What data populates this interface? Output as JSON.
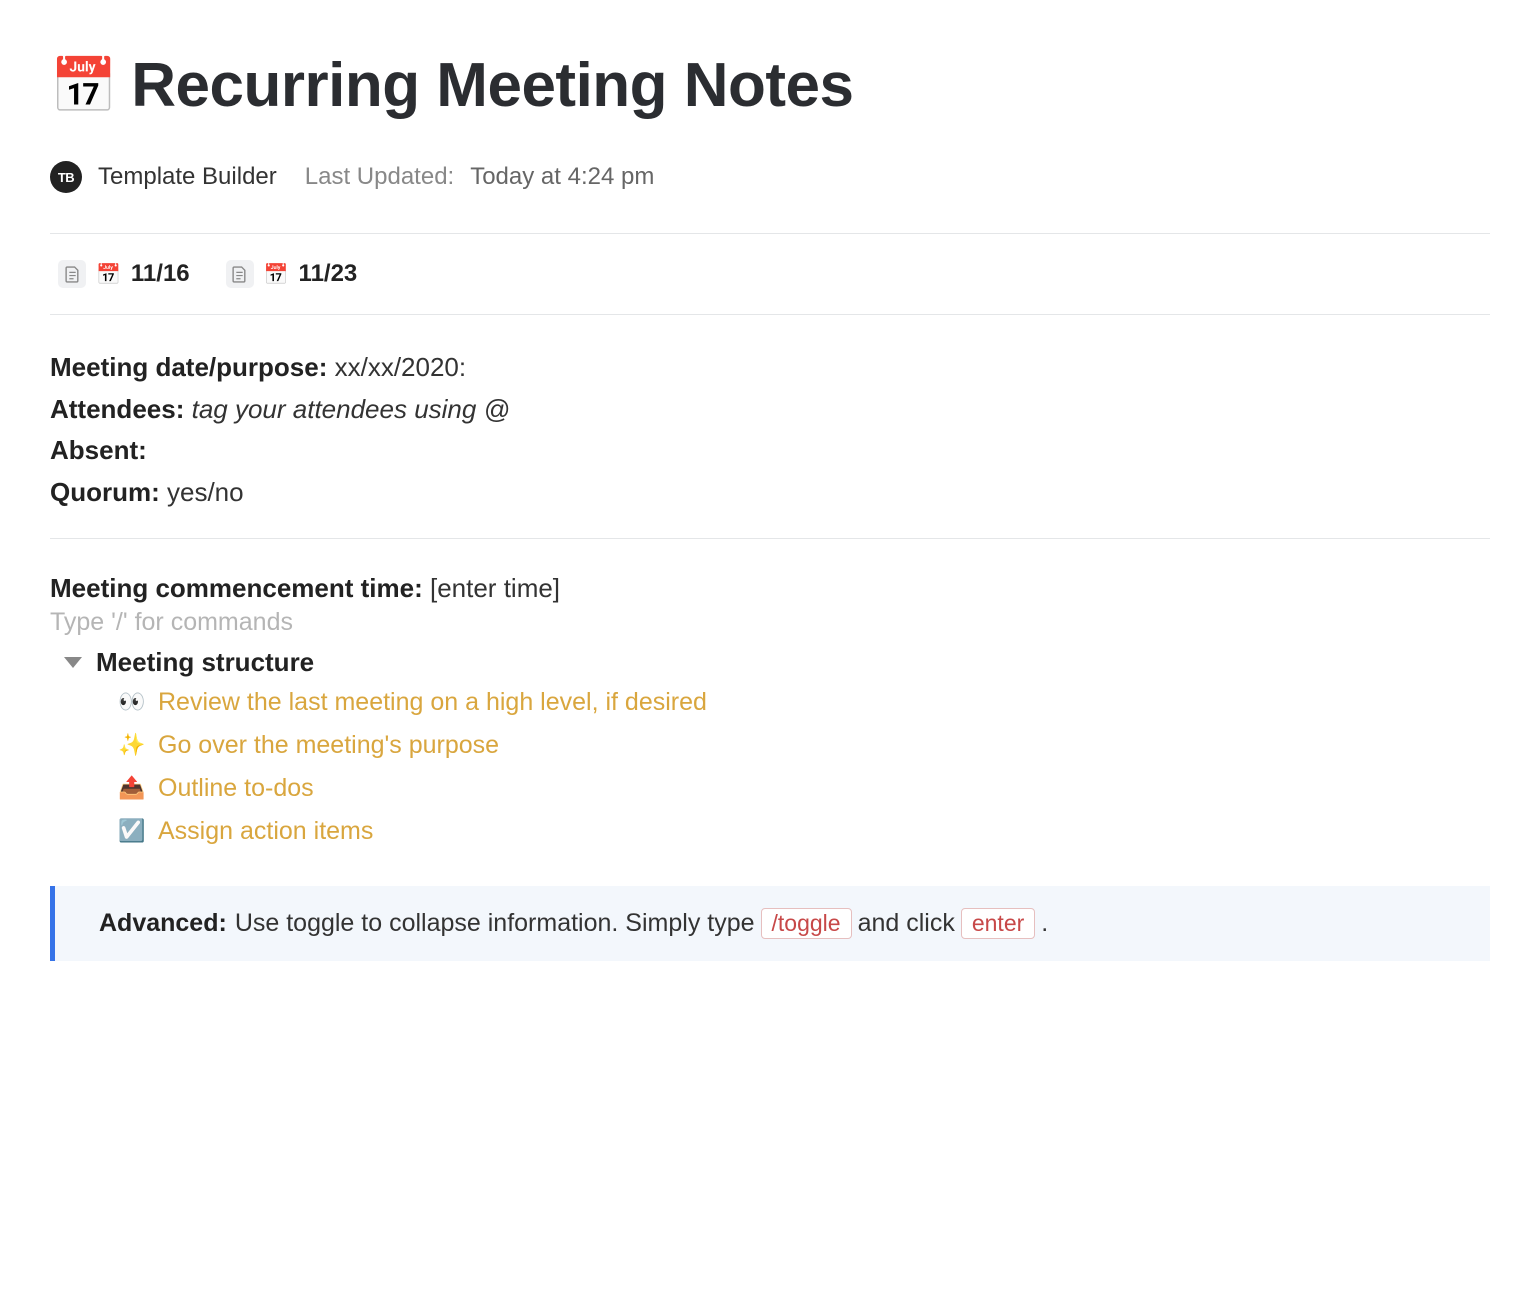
{
  "header": {
    "icon": "📅",
    "title": "Recurring Meeting Notes"
  },
  "meta": {
    "avatar_initials": "TB",
    "author": "Template Builder",
    "last_updated_label": "Last Updated:",
    "last_updated_value": "Today at 4:24 pm"
  },
  "subpages": [
    {
      "emoji": "📅",
      "label": "11/16"
    },
    {
      "emoji": "📅",
      "label": "11/23"
    }
  ],
  "fields": {
    "meeting_date_purpose": {
      "label": "Meeting date/purpose:",
      "value": "xx/xx/2020:"
    },
    "attendees": {
      "label": "Attendees:",
      "value": "tag your attendees using @"
    },
    "absent": {
      "label": "Absent:",
      "value": ""
    },
    "quorum": {
      "label": "Quorum:",
      "value": "yes/no"
    }
  },
  "commencement": {
    "label": "Meeting commencement time:",
    "value": "[enter time]"
  },
  "editor_placeholder": "Type '/' for commands",
  "toggle": {
    "title": "Meeting structure",
    "items": [
      {
        "icon": "👀",
        "text": "Review the last meeting on a high level, if desired"
      },
      {
        "icon": "✨",
        "text": "Go over the meeting's purpose"
      },
      {
        "icon": "📤",
        "text": "Outline to-dos"
      },
      {
        "icon": "☑️",
        "text": "Assign action items"
      }
    ]
  },
  "callout": {
    "label": "Advanced:",
    "text_before": "Use toggle to collapse information. Simply type",
    "code1": "/toggle",
    "text_mid": "and click",
    "code2": "enter",
    "text_after": "."
  }
}
